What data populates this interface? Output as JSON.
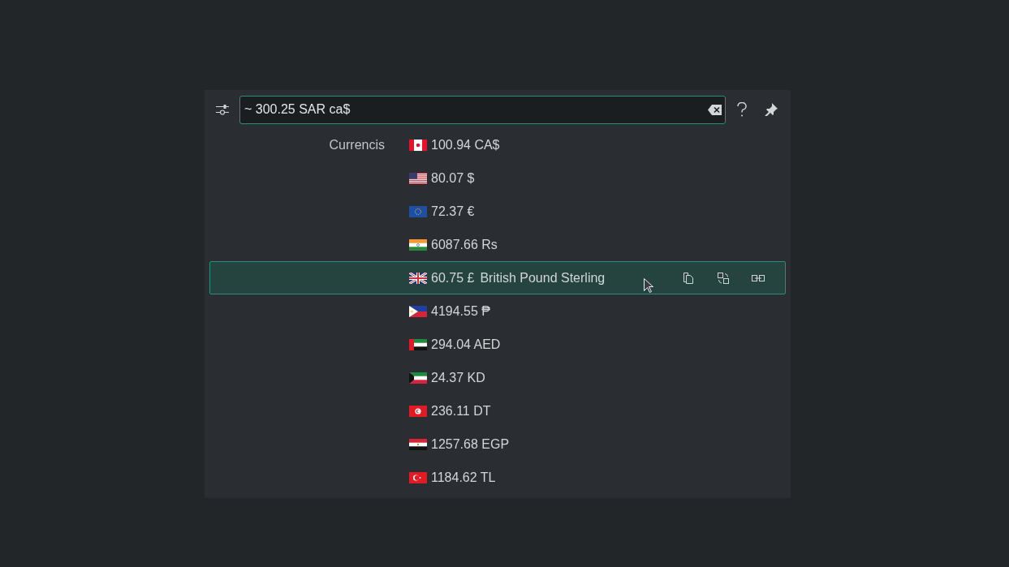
{
  "search": {
    "value": "~ 300.25 SAR ca$"
  },
  "category": "Currencis",
  "results": [
    {
      "kind": "canada",
      "amount": "100.94 CA$",
      "selected": false
    },
    {
      "kind": "usa",
      "amount": "80.07 $",
      "selected": false
    },
    {
      "kind": "eu",
      "amount": "72.37 €",
      "selected": false
    },
    {
      "kind": "india",
      "amount": "6087.66 Rs",
      "selected": false
    },
    {
      "kind": "uk",
      "amount": "60.75 £",
      "description": "British Pound Sterling",
      "selected": true
    },
    {
      "kind": "philippines",
      "amount": "4194.55 ₱",
      "selected": false
    },
    {
      "kind": "uae",
      "amount": "294.04 AED",
      "selected": false
    },
    {
      "kind": "kuwait",
      "amount": "24.37 KD",
      "selected": false
    },
    {
      "kind": "tunisia",
      "amount": "236.11 DT",
      "selected": false
    },
    {
      "kind": "egypt",
      "amount": "1257.68 EGP",
      "selected": false
    },
    {
      "kind": "turkey",
      "amount": "1184.62 TL",
      "selected": false
    }
  ],
  "actions": [
    {
      "kind": "copy"
    },
    {
      "kind": "convert"
    },
    {
      "kind": "link"
    }
  ]
}
